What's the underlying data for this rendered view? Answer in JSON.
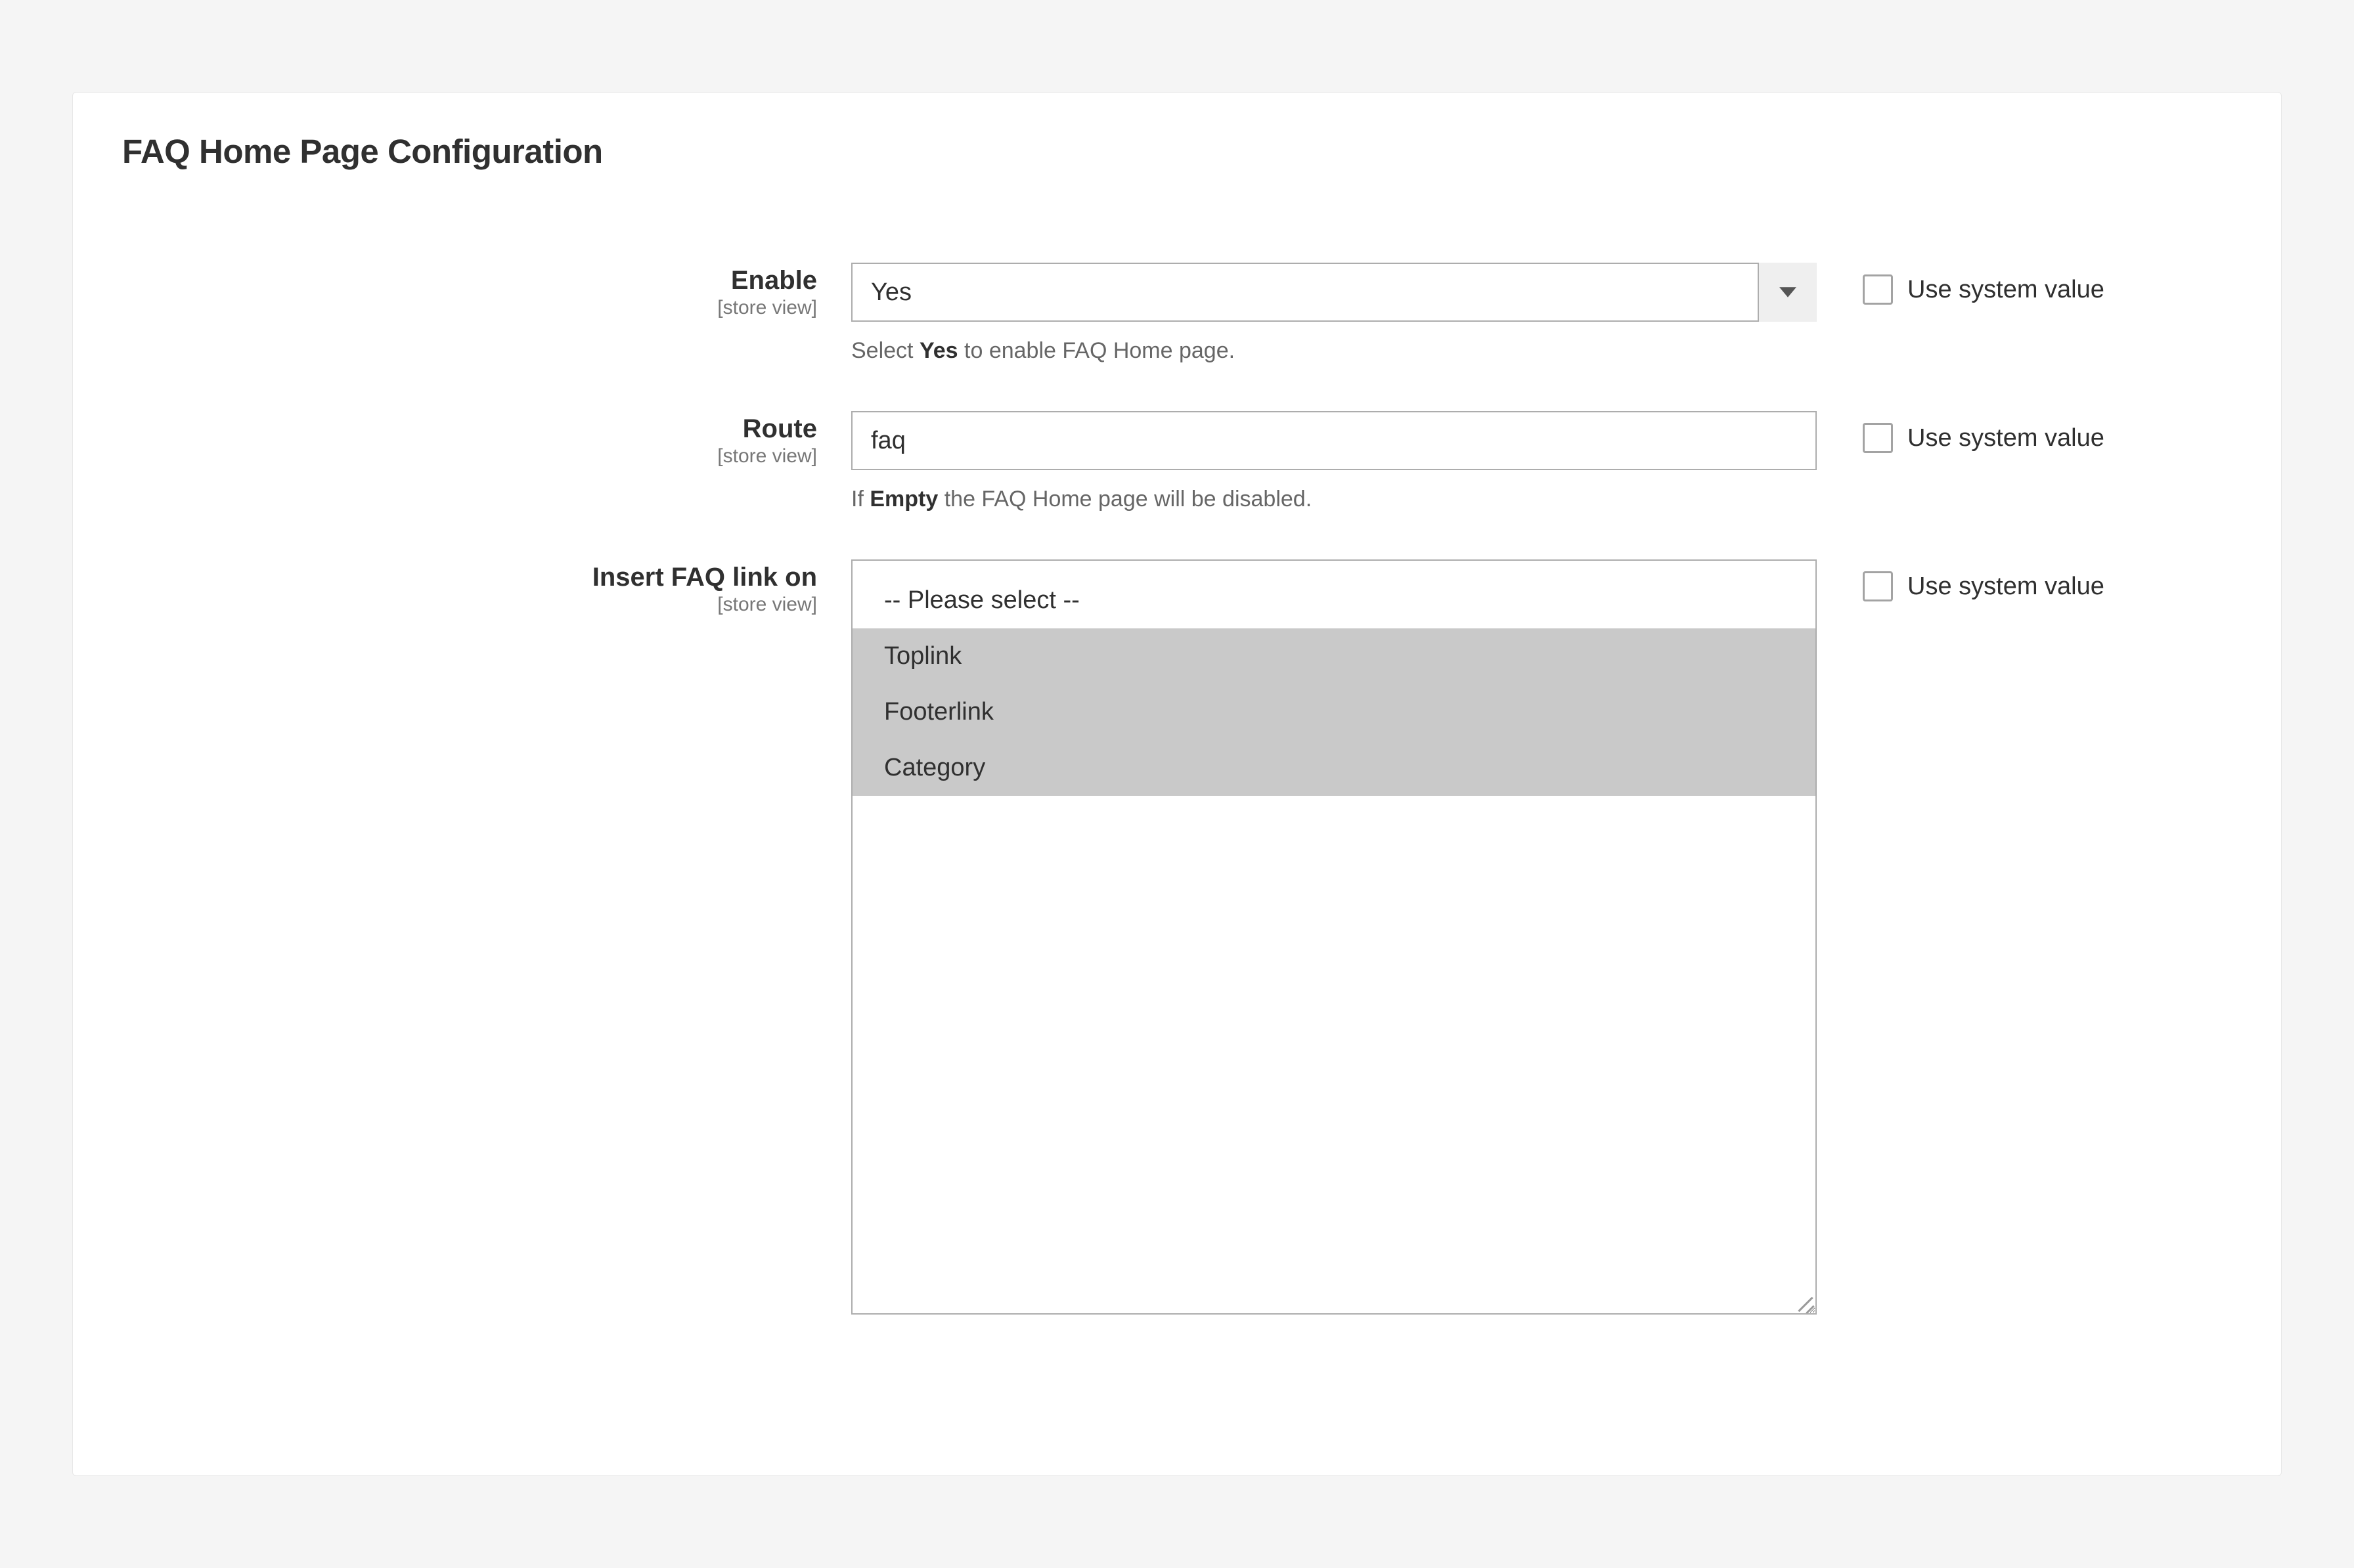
{
  "panel": {
    "title": "FAQ Home Page Configuration"
  },
  "common": {
    "scope_label": "[store view]",
    "use_system_value": "Use system value"
  },
  "fields": {
    "enable": {
      "label": "Enable",
      "selected": "Yes",
      "help_pre": "Select ",
      "help_bold": "Yes",
      "help_post": " to enable FAQ Home page."
    },
    "route": {
      "label": "Route",
      "value": "faq",
      "help_pre": "If ",
      "help_bold": "Empty",
      "help_post": " the FAQ Home page will be disabled."
    },
    "insert_link": {
      "label": "Insert FAQ link on",
      "options": [
        {
          "label": "-- Please select --",
          "selected": false
        },
        {
          "label": "Toplink",
          "selected": true
        },
        {
          "label": "Footerlink",
          "selected": true
        },
        {
          "label": "Category",
          "selected": true
        }
      ]
    }
  }
}
